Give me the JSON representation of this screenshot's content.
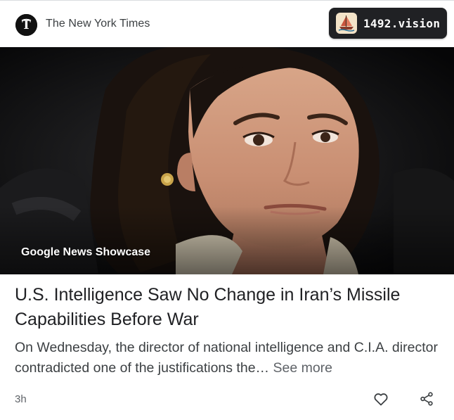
{
  "header": {
    "publisher_name": "The New York Times",
    "publisher_logo_glyph": "𝕿"
  },
  "watermark": {
    "label": "1492.vision"
  },
  "article": {
    "badge": "Google News Showcase",
    "headline": "U.S. Intelligence Saw No Change in Iran’s Missile Capabilities Before War",
    "snippet": "On Wednesday, the director of national intelligence and C.I.A. director contradicted one of the justifications the… ",
    "see_more": "See more",
    "time": "3h"
  },
  "actions": {
    "like_icon": "heart-icon",
    "share_icon": "share-icon"
  },
  "colors": {
    "text_primary": "#202124",
    "text_secondary": "#5f6368",
    "watermark_bg": "#202124"
  }
}
